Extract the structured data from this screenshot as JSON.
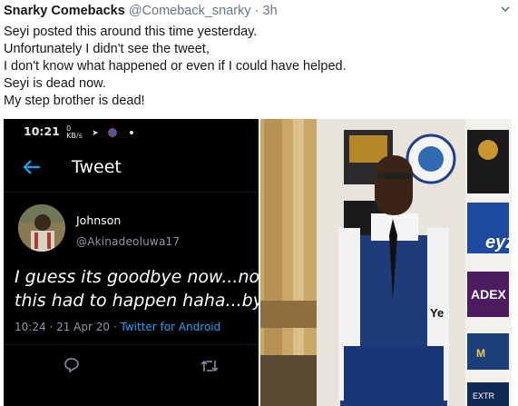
{
  "tweet": {
    "display_name": "Snarky Comebacks",
    "handle": "@Comeback_snarky",
    "separator": "·",
    "time": "3h",
    "lines": [
      "Seyi posted this around this time yesterday.",
      "Unfortunately I didn't see the tweet,",
      "I don't know what happened or even if I could have helped.",
      "Seyi is dead now.",
      "My step brother is dead!"
    ]
  },
  "screenshot": {
    "status_time": "10:21",
    "status_small_top": "0",
    "status_small_bottom": "KB/s",
    "screen_title": "Tweet",
    "author_name": "Johnson",
    "author_handle": "@Akinadeoluwa17",
    "text_line1": "I guess its goodbye now...no c",
    "text_line2": "this had to happen haha...bye",
    "meta_time": "10:24",
    "meta_dot1": "·",
    "meta_date": "21 Apr 20",
    "meta_dot2": "·",
    "meta_client": "Twitter for Android"
  },
  "photo": {
    "banner_text_1": "Ye",
    "banner_text_2": "ADEX",
    "banner_text_3": "M",
    "banner_text_4": "eyz",
    "banner_text_5": "EXTR"
  },
  "colors": {
    "link_blue": "#1da1f2",
    "muted_gray": "#657786"
  }
}
